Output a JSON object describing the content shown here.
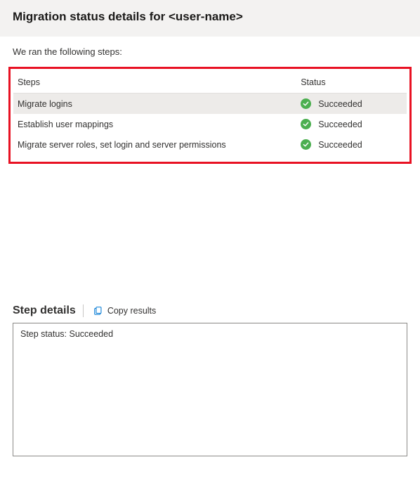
{
  "header": {
    "title": "Migration status details for <user-name>"
  },
  "subhead": "We ran the following steps:",
  "table": {
    "header_steps": "Steps",
    "header_status": "Status",
    "rows": [
      {
        "step": "Migrate logins",
        "status": "Succeeded"
      },
      {
        "step": "Establish user mappings",
        "status": "Succeeded"
      },
      {
        "step": "Migrate server roles, set login and server permissions",
        "status": "Succeeded"
      }
    ]
  },
  "details": {
    "title": "Step details",
    "copy_label": "Copy results",
    "status_text": "Step status: Succeeded"
  }
}
